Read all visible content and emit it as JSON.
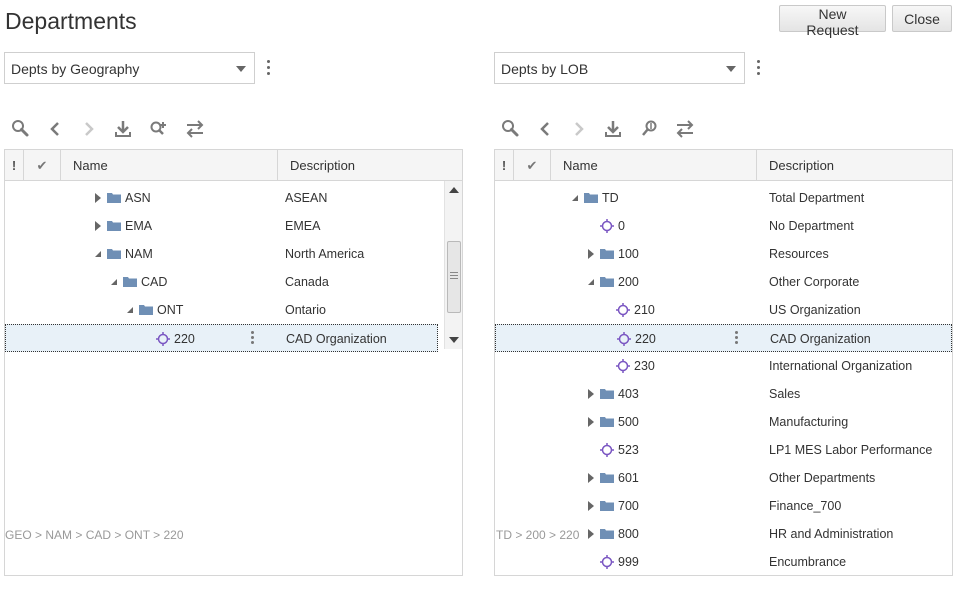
{
  "page": {
    "title": "Departments",
    "new_request_label": "New Request",
    "close_label": "Close"
  },
  "left": {
    "hierarchy": "Depts by Geography",
    "columns": {
      "bang": "!",
      "check": "✔",
      "name": "Name",
      "description": "Description"
    },
    "rows": [
      {
        "name": "ASN",
        "description": "ASEAN",
        "kind": "folder",
        "state": "collapsed",
        "level": 0
      },
      {
        "name": "EMA",
        "description": "EMEA",
        "kind": "folder",
        "state": "collapsed",
        "level": 0
      },
      {
        "name": "NAM",
        "description": "North America",
        "kind": "folder",
        "state": "expanded",
        "level": 0
      },
      {
        "name": "CAD",
        "description": "Canada",
        "kind": "folder",
        "state": "expanded",
        "level": 1
      },
      {
        "name": "ONT",
        "description": "Ontario",
        "kind": "folder",
        "state": "expanded",
        "level": 2
      },
      {
        "name": "220",
        "description": "CAD Organization",
        "kind": "member",
        "state": "leaf",
        "level": 3,
        "selected": true
      }
    ],
    "breadcrumb": "GEO > NAM > CAD > ONT > 220"
  },
  "right": {
    "hierarchy": "Depts by LOB",
    "columns": {
      "bang": "!",
      "check": "✔",
      "name": "Name",
      "description": "Description"
    },
    "rows": [
      {
        "name": "TD",
        "description": "Total Department",
        "kind": "folder",
        "state": "expanded",
        "level": 0
      },
      {
        "name": "0",
        "description": "No Department",
        "kind": "member",
        "state": "leaf",
        "level": 1
      },
      {
        "name": "100",
        "description": "Resources",
        "kind": "folder",
        "state": "collapsed",
        "level": 1
      },
      {
        "name": "200",
        "description": "Other Corporate",
        "kind": "folder",
        "state": "expanded",
        "level": 1
      },
      {
        "name": "210",
        "description": "US Organization",
        "kind": "member",
        "state": "leaf",
        "level": 2
      },
      {
        "name": "220",
        "description": "CAD Organization",
        "kind": "member",
        "state": "leaf",
        "level": 2,
        "selected": true
      },
      {
        "name": "230",
        "description": "International Organization",
        "kind": "member",
        "state": "leaf",
        "level": 2
      },
      {
        "name": "403",
        "description": "Sales",
        "kind": "folder",
        "state": "collapsed",
        "level": 1
      },
      {
        "name": "500",
        "description": "Manufacturing",
        "kind": "folder",
        "state": "collapsed",
        "level": 1
      },
      {
        "name": "523",
        "description": "LP1 MES Labor Performance",
        "kind": "member",
        "state": "leaf",
        "level": 1
      },
      {
        "name": "601",
        "description": "Other Departments",
        "kind": "folder",
        "state": "collapsed",
        "level": 1
      },
      {
        "name": "700",
        "description": "Finance_700",
        "kind": "folder",
        "state": "collapsed",
        "level": 1
      },
      {
        "name": "800",
        "description": "HR and Administration",
        "kind": "folder",
        "state": "collapsed",
        "level": 1
      },
      {
        "name": "999",
        "description": "Encumbrance",
        "kind": "member",
        "state": "leaf",
        "level": 1
      }
    ],
    "breadcrumb": "TD > 200 > 220"
  },
  "colors": {
    "folder": "#6f8fb5",
    "member": "#7a56c2",
    "selection": "#e8f1f8",
    "toolbar_icon": "#7a7a7a"
  },
  "icons": {
    "toolbar": [
      "search-icon",
      "previous-icon",
      "next-icon",
      "download-icon",
      "locate-icon",
      "swap-icon"
    ]
  }
}
